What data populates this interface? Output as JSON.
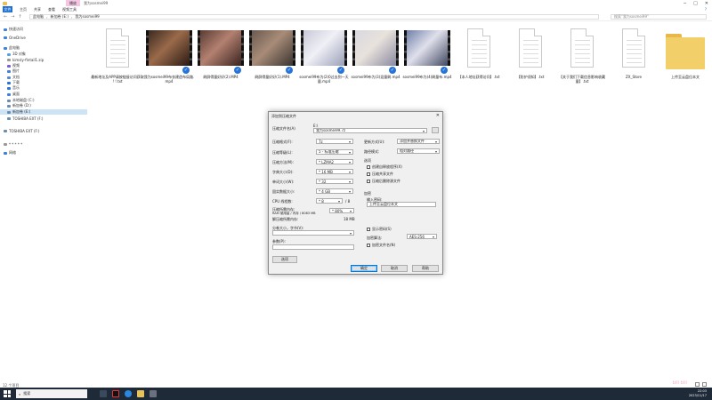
{
  "window": {
    "manage_tab": "播放",
    "title": "我为sosmei99",
    "ribbon_tabs": [
      "文件",
      "主页",
      "共享",
      "查看",
      "视频工具"
    ],
    "help": "?"
  },
  "address": {
    "crumbs": [
      "此电脑",
      "新加卷 (E:)",
      "我为sosmei99"
    ],
    "search_placeholder": "搜索\"我为sosmei99\""
  },
  "nav": {
    "items": [
      {
        "label": "快速访问",
        "color": "#3b82d8"
      },
      {
        "label": "OneDrive",
        "color": "#3b82d8"
      },
      {
        "label": "此电脑",
        "color": "#3b82d8"
      },
      {
        "label": "3D 对象",
        "color": "#5aa0e0"
      },
      {
        "label": "kimsly-fintail1.zip",
        "color": "#999"
      },
      {
        "label": "视频",
        "color": "#7a5bd0"
      },
      {
        "label": "图片",
        "color": "#3b82d8"
      },
      {
        "label": "文档",
        "color": "#5a88c8"
      },
      {
        "label": "下载",
        "color": "#2a75d0"
      },
      {
        "label": "音乐",
        "color": "#2a75d0"
      },
      {
        "label": "桌面",
        "color": "#3b82d8"
      },
      {
        "label": "本地磁盘 (C:)",
        "color": "#6a8db0"
      },
      {
        "label": "新加卷 (D:)",
        "color": "#6a8db0"
      },
      {
        "label": "新加卷 (E:)",
        "color": "#6a8db0"
      },
      {
        "label": "TOSHIBA EXT (F:)",
        "color": "#6a8db0"
      },
      {
        "label": "TOSHIBA EXT (F:)",
        "color": "#6a8db0"
      },
      {
        "label": "* * * * *",
        "color": "#999"
      },
      {
        "label": "网络",
        "color": "#3b82d8"
      }
    ]
  },
  "files": [
    {
      "kind": "doc",
      "name": "最新地址及APP请按链接访问获取 ! !.txt"
    },
    {
      "kind": "vid",
      "name": "我为sosmei99布衣建造布局路.mp4",
      "palette": [
        "#3a2a20",
        "#9a6a4a",
        "#2a1a14"
      ]
    },
    {
      "kind": "vid",
      "name": "刷屏得量好好(2).MP4",
      "palette": [
        "#5a3c34",
        "#b38070",
        "#3a2420"
      ]
    },
    {
      "kind": "vid",
      "name": "刷屏得量好好(1).MP4",
      "palette": [
        "#6a5a50",
        "#a88c78",
        "#3a3430"
      ]
    },
    {
      "kind": "vid",
      "name": "sosmei99布为(2)0过去到一天量.mp4",
      "palette": [
        "#c8c8d8",
        "#f0f0f6",
        "#9aa0b8"
      ]
    },
    {
      "kind": "vid",
      "name": "sosmei99布为(3)混量刷.mp4",
      "palette": [
        "#d8d8e0",
        "#e8e2dc",
        "#8a8aa0"
      ]
    },
    {
      "kind": "vid",
      "name": "sosmei99布为(4)刷量布.mp4",
      "palette": [
        "#7080a8",
        "#e0e0ec",
        "#404860"
      ]
    },
    {
      "kind": "doc",
      "name": "【本人地址获得访问】.txt"
    },
    {
      "kind": "doc",
      "name": "【防护须知】.txt"
    },
    {
      "kind": "doc",
      "name": "【关于我们下载信息影响收藏量】.txt"
    },
    {
      "kind": "doc",
      "name": "ZX_Store"
    },
    {
      "kind": "folder",
      "name": "上传至云盘位本文"
    }
  ],
  "status": {
    "count": "12 个项目"
  },
  "dialog": {
    "title": "添加到压缩文件",
    "archive_name_label": "压缩文件名(A)",
    "archive_name_prefix": "E:\\",
    "archive_name": "我为sosmei99.7z",
    "archive_format_label": "压缩格式(F):",
    "archive_format": "7z",
    "compression_level_label": "压缩等级(L):",
    "compression_level": "5 - 标准压缩",
    "compression_method_label": "压缩方法(M):",
    "compression_method": "* LZMA2",
    "dictionary_label": "字典大小(D):",
    "dictionary": "* 16 MB",
    "word_label": "单词大小(W):",
    "word": "* 32",
    "solid_label": "固实数据大小:",
    "solid": "* 4 GB",
    "cpu_label": "CPU 线程数:",
    "cpu": "* 8",
    "cpu_total": "/ 8",
    "memory_label": "压缩所需内存:",
    "memory_detail": "RAM 使用量 / 内存 / 8083 MB",
    "memory_value": "* 80%",
    "decompress_memory_label": "解压缩所需内存:",
    "decompress_memory_value": "18 MB",
    "split_label": "分卷大小，字节(V):",
    "split_value": "",
    "params_label": "参数(P):",
    "params_value": "",
    "options_button": "选项",
    "update_mode_label": "更新方式(U):",
    "update_mode": "添加并替换文件",
    "path_mode_label": "路径模式:",
    "path_mode": "相对路径",
    "options_title": "选项",
    "opt1": "创建自释放程序(X)",
    "opt2": "压缩共享文件",
    "opt3": "压缩后删除源文件",
    "encrypt_title": "加密",
    "password_label": "输入密码:",
    "password_value": "上传至云盘位本文",
    "show_password": "显示密码(S)",
    "encrypt_method_label": "加密算法:",
    "encrypt_method": "AES-256",
    "encrypt_names": "加密文件名(N)",
    "ok": "确定",
    "cancel": "取消",
    "help": "帮助"
  },
  "taskbar": {
    "search": "搜索",
    "time": "22:03",
    "date": "2023/11/17"
  },
  "watermark": "bili bili"
}
